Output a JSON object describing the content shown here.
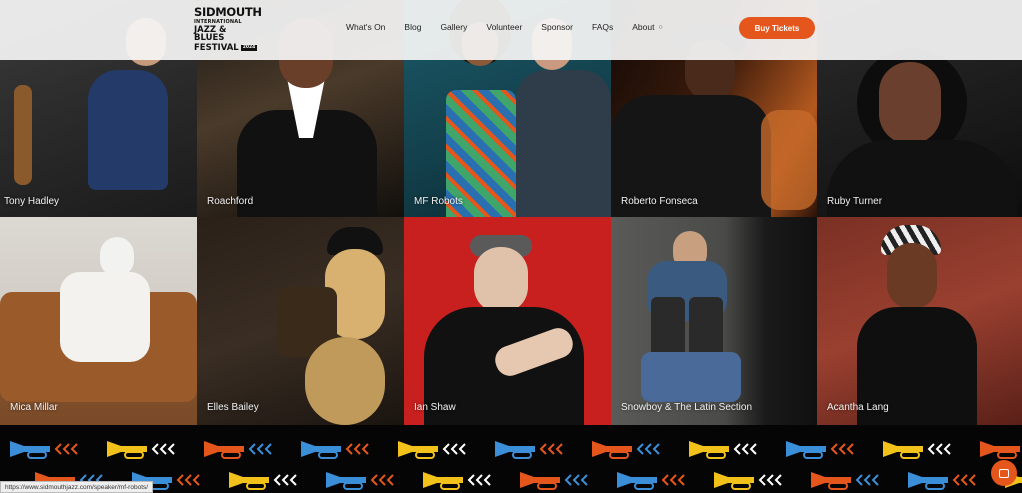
{
  "header": {
    "logo": {
      "line1": "SIDMOUTH",
      "line2": "INTERNATIONAL",
      "line3": "JAZZ & BLUES",
      "line4": "FESTIVAL",
      "year": "2024"
    },
    "nav": [
      {
        "label": "What's On"
      },
      {
        "label": "Blog"
      },
      {
        "label": "Gallery"
      },
      {
        "label": "Volunteer"
      },
      {
        "label": "Sponsor"
      },
      {
        "label": "FAQs"
      },
      {
        "label": "About",
        "has_dropdown": true
      }
    ],
    "cta": "Buy Tickets"
  },
  "artists": [
    {
      "name": "Tony Hadley"
    },
    {
      "name": "Roachford"
    },
    {
      "name": "MF Robots"
    },
    {
      "name": "Roberto Fonseca"
    },
    {
      "name": "Ruby Turner"
    },
    {
      "name": "Mica Millar"
    },
    {
      "name": "Elles Bailey"
    },
    {
      "name": "Ian Shaw"
    },
    {
      "name": "Snowboy & The Latin Section"
    },
    {
      "name": "Acantha Lang"
    }
  ],
  "status_url": "https://www.sidmouthjazz.com/speaker/mf-robots/",
  "colors": {
    "accent": "#e4561b",
    "pattern": [
      "#3a8fd8",
      "#f2c21b",
      "#e4561b",
      "#ffffff"
    ]
  }
}
